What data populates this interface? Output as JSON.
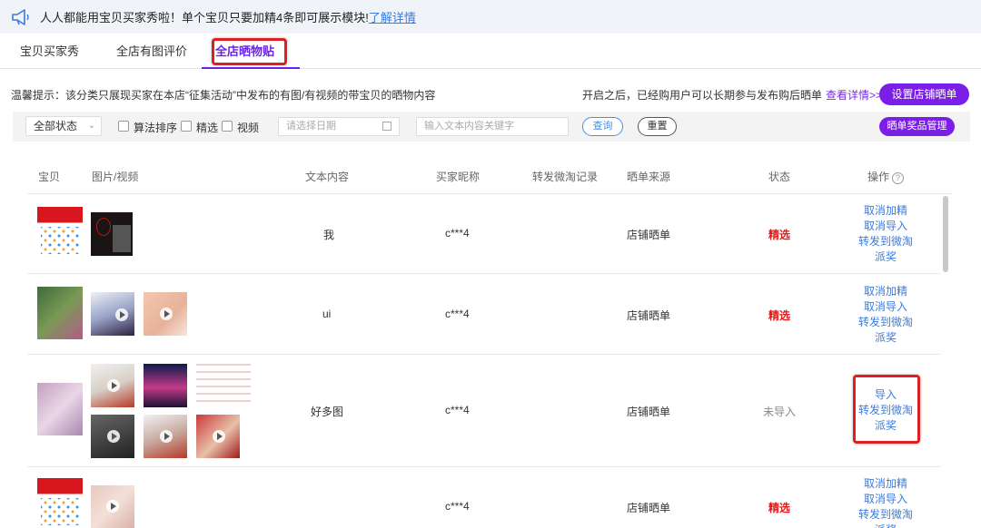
{
  "notice": {
    "text": "人人都能用宝贝买家秀啦！单个宝贝只要加精4条即可展示模块!",
    "link": "了解详情"
  },
  "tabs": [
    {
      "label": "宝贝买家秀"
    },
    {
      "label": "全店有图评价"
    },
    {
      "label": "全店晒物贴"
    }
  ],
  "tip": {
    "left": "温馨提示：该分类只展现买家在本店“征集活动”中发布的有图/有视频的带宝贝的晒物内容",
    "right": "开启之后，已经购用户可以长期参与发布购后晒单",
    "right_link": "查看详情>>",
    "setup_button": "设置店铺晒单"
  },
  "filter": {
    "status_select": "全部状态",
    "checkboxes": [
      "算法排序",
      "精选",
      "视频"
    ],
    "date_placeholder": "请选择日期",
    "search_placeholder": "输入文本内容关键字",
    "query_button": "查询",
    "reset_button": "重置",
    "prize_button": "晒单奖品管理"
  },
  "table": {
    "headers": [
      "宝贝",
      "图片/视频",
      "文本内容",
      "买家昵称",
      "转发微淘记录",
      "晒单来源",
      "状态",
      "操作"
    ],
    "help_icon": "?",
    "rows": [
      {
        "text": "我",
        "buyer": "c***4",
        "source": "店铺晒单",
        "status": "精选",
        "ops": [
          "取消加精",
          "取消导入",
          "转发到微淘",
          "派奖"
        ]
      },
      {
        "text": "ui",
        "buyer": "c***4",
        "source": "店铺晒单",
        "status": "精选",
        "ops": [
          "取消加精",
          "取消导入",
          "转发到微淘",
          "派奖"
        ]
      },
      {
        "text": "好多图",
        "buyer": "c***4",
        "source": "店铺晒单",
        "status": "未导入",
        "ops": [
          "导入",
          "转发到微淘",
          "派奖"
        ]
      },
      {
        "text": "",
        "buyer": "c***4",
        "source": "店铺晒单",
        "status": "精选",
        "ops": [
          "取消加精",
          "取消导入",
          "转发到微淘",
          "派奖"
        ]
      }
    ]
  },
  "colors": {
    "accent": "#6b23e8",
    "link": "#3a7be0",
    "selected_status": "#e01a1a",
    "highlight_box": "#e02020"
  }
}
